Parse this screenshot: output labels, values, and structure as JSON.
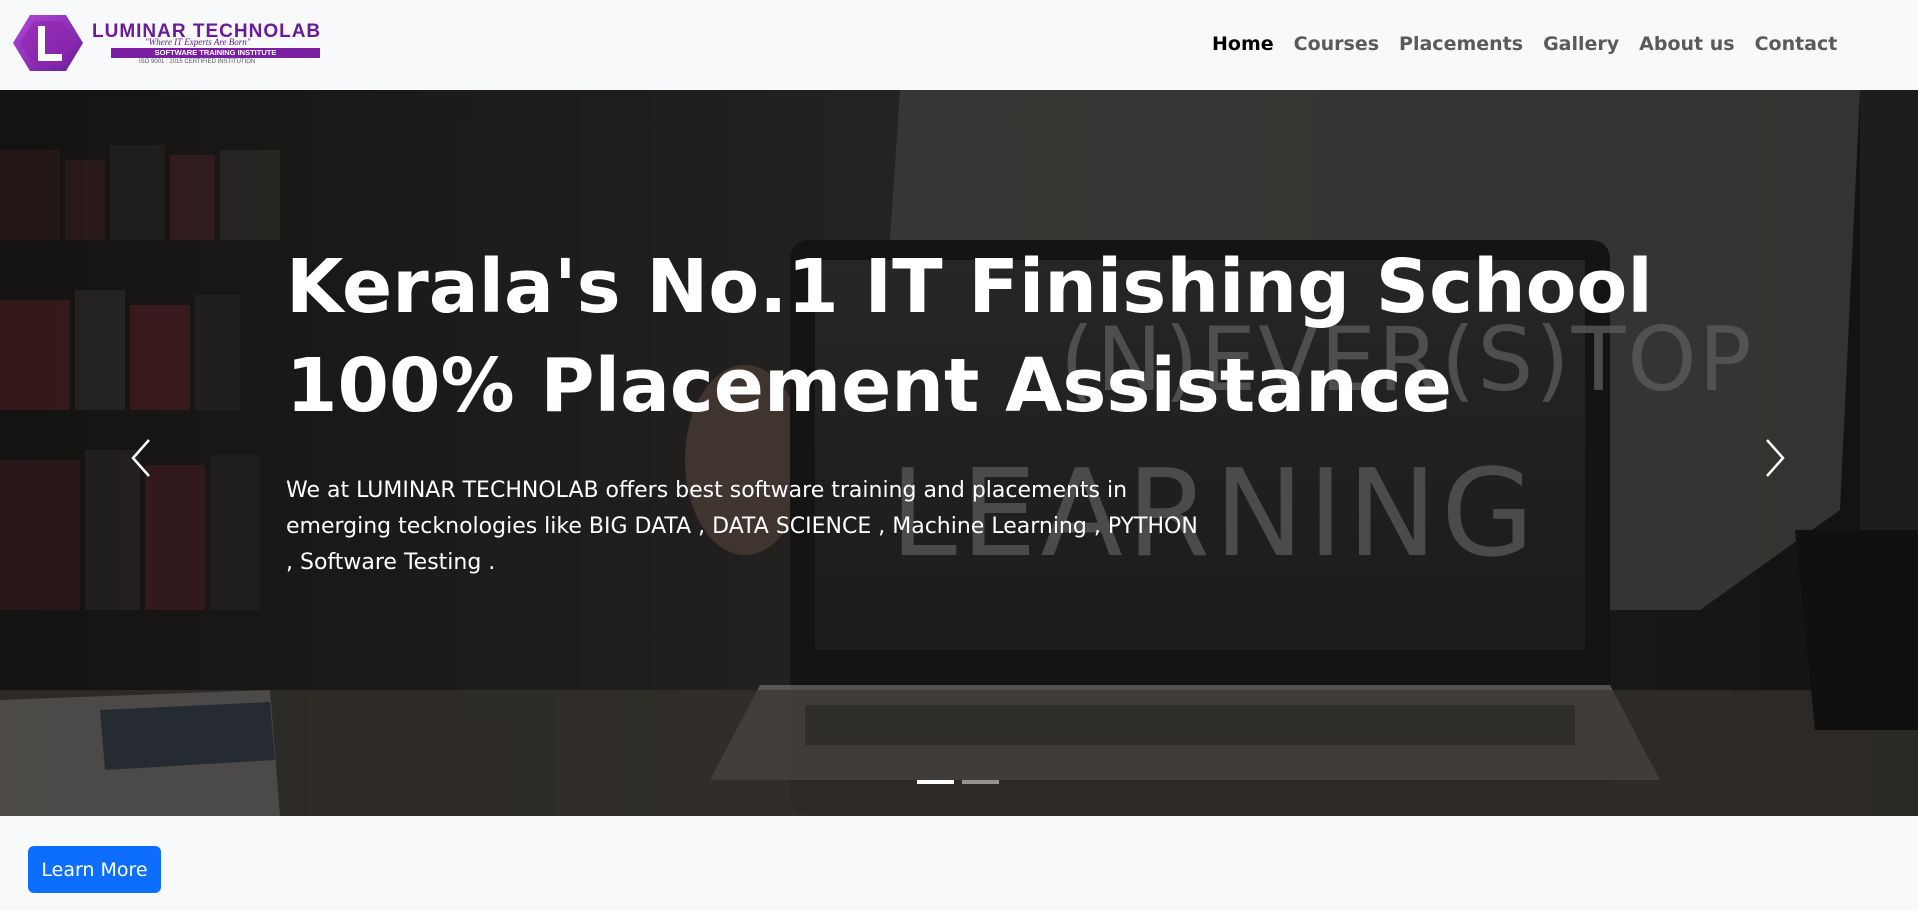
{
  "brand": {
    "name": "LUMINAR TECHNOLAB",
    "tagline": "\"Where IT Experts Are Born\"",
    "band_text": "SOFTWARE TRAINING INSTITUTE",
    "iso_text": "ISO 9001 : 2015 CERTIFIED INSTITUTION",
    "logo_letter": "L",
    "colors": {
      "primary": "#6a1b9a",
      "accent": "#9c27b0"
    }
  },
  "nav": {
    "items": [
      {
        "label": "Home",
        "active": true
      },
      {
        "label": "Courses",
        "active": false
      },
      {
        "label": "Placements",
        "active": false
      },
      {
        "label": "Gallery",
        "active": false
      },
      {
        "label": "About us",
        "active": false
      },
      {
        "label": "Contact",
        "active": false
      }
    ]
  },
  "hero": {
    "title_line1": "Kerala's No.1 IT Finishing School",
    "title_line2": "100% Placement Assistance",
    "description": "We at LUMINAR TECHNOLAB offers best software training and placements in emerging tecknologies like BIG DATA , DATA SCIENCE , Machine Learning , PYTHON , Software Testing .",
    "slide_count": 2,
    "active_slide": 1,
    "prev_icon": "chevron-left-icon",
    "next_icon": "chevron-right-icon"
  },
  "cta": {
    "label": "Learn More",
    "color": "#0d6efd"
  }
}
